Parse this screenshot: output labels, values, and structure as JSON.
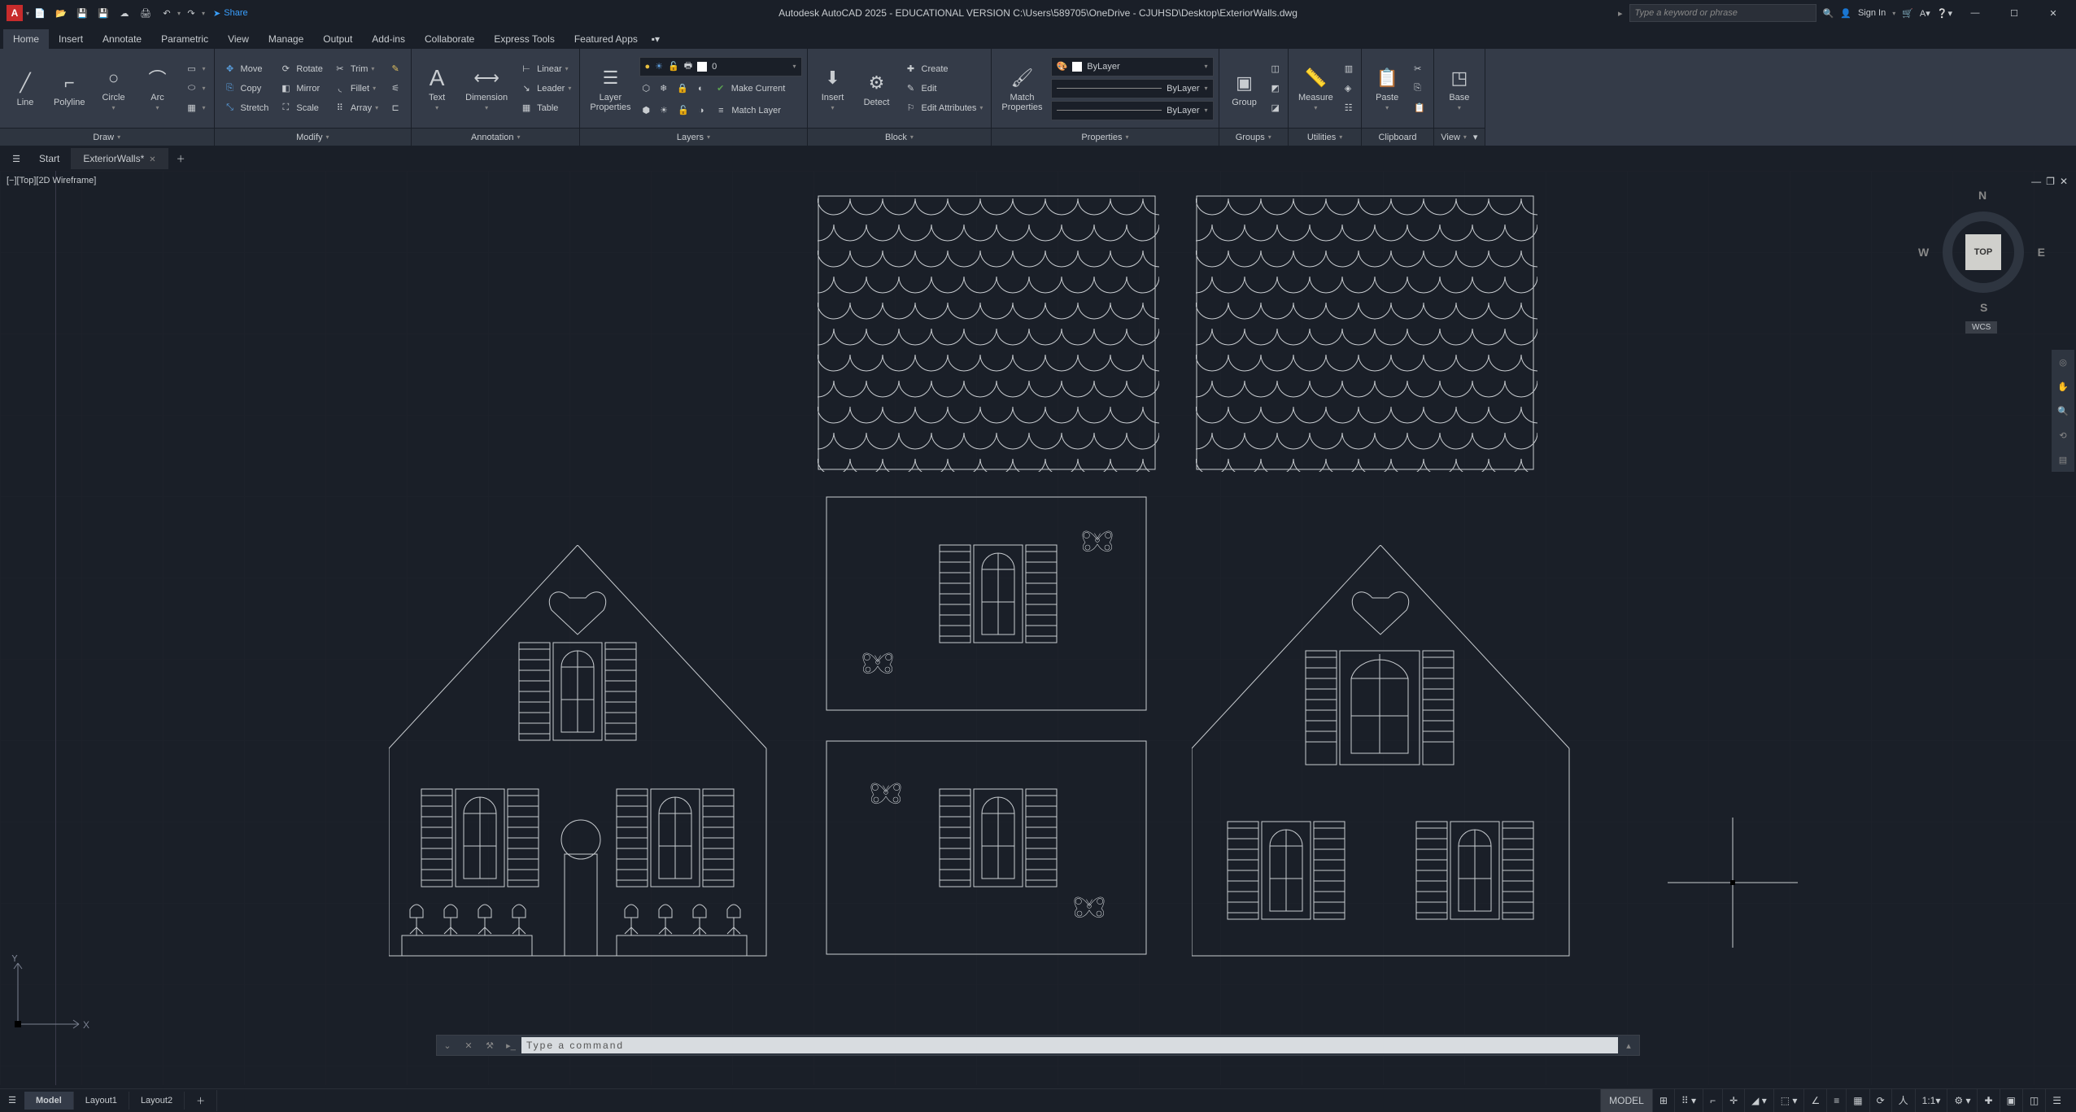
{
  "titlebar": {
    "share": "Share",
    "title": "Autodesk AutoCAD 2025 - EDUCATIONAL VERSION    C:\\Users\\589705\\OneDrive - CJUHSD\\Desktop\\ExteriorWalls.dwg",
    "search_placeholder": "Type a keyword or phrase",
    "sign_in": "Sign In"
  },
  "menus": [
    "Home",
    "Insert",
    "Annotate",
    "Parametric",
    "View",
    "Manage",
    "Output",
    "Add-ins",
    "Collaborate",
    "Express Tools",
    "Featured Apps"
  ],
  "ribbon": {
    "draw": {
      "line": "Line",
      "polyline": "Polyline",
      "circle": "Circle",
      "arc": "Arc",
      "footer": "Draw"
    },
    "modify": {
      "move": "Move",
      "rotate": "Rotate",
      "trim": "Trim",
      "copy": "Copy",
      "mirror": "Mirror",
      "fillet": "Fillet",
      "stretch": "Stretch",
      "scale": "Scale",
      "array": "Array",
      "footer": "Modify"
    },
    "annotation": {
      "text": "Text",
      "dimension": "Dimension",
      "linear": "Linear",
      "leader": "Leader",
      "table": "Table",
      "footer": "Annotation"
    },
    "layers": {
      "properties": "Layer\nProperties",
      "make_current": "Make Current",
      "match_layer": "Match Layer",
      "layer0": "0",
      "footer": "Layers"
    },
    "block": {
      "insert": "Insert",
      "detect": "Detect",
      "create": "Create",
      "edit": "Edit",
      "edit_attributes": "Edit Attributes",
      "footer": "Block"
    },
    "properties": {
      "match": "Match\nProperties",
      "bylayer": "ByLayer",
      "footer": "Properties"
    },
    "groups": {
      "group": "Group",
      "footer": "Groups"
    },
    "utilities": {
      "measure": "Measure",
      "footer": "Utilities"
    },
    "clipboard": {
      "paste": "Paste",
      "footer": "Clipboard"
    },
    "view": {
      "base": "Base",
      "footer": "View"
    }
  },
  "filetabs": {
    "start": "Start",
    "current": "ExteriorWalls*"
  },
  "viewport_label": "[−][Top][2D Wireframe]",
  "viewcube": {
    "top": "TOP",
    "n": "N",
    "s": "S",
    "e": "E",
    "w": "W",
    "wcs": "WCS"
  },
  "ucs": {
    "x": "X",
    "y": "Y"
  },
  "cmdline": {
    "placeholder": "Type a command"
  },
  "layouttabs": {
    "model": "Model",
    "layout1": "Layout1",
    "layout2": "Layout2"
  },
  "status": {
    "model": "MODEL",
    "scale": "1:1"
  }
}
